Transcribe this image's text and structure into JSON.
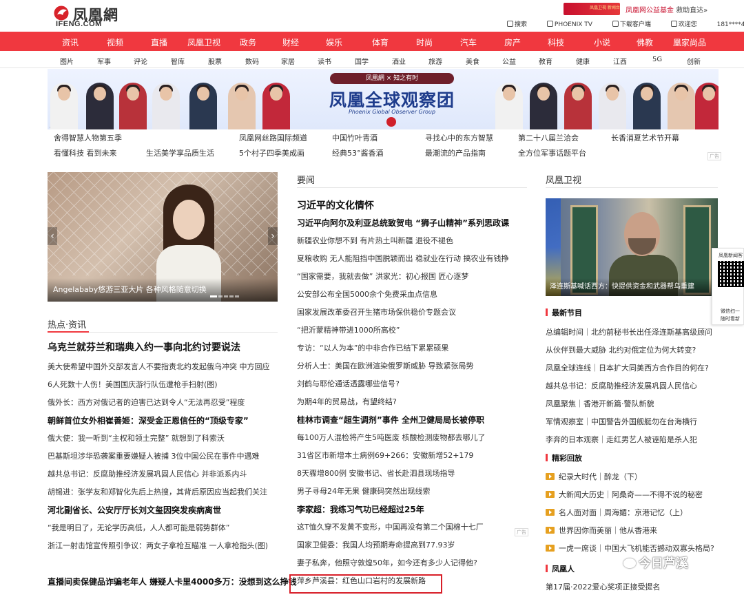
{
  "header": {
    "logo_cn": "凤凰網",
    "logo_en": "IFENG.COM",
    "banner_text": "凤凰卫视 新闻台",
    "fund_label": "凤凰网公益基金",
    "fund_link": "救助直达»",
    "links": [
      {
        "icon": "search-icon",
        "label": "搜索"
      },
      {
        "icon": "tv-icon",
        "label": "PHOENIX TV"
      },
      {
        "icon": "download-icon",
        "label": "下载客户端"
      },
      {
        "icon": "user-icon",
        "label": "欢迎您"
      },
      {
        "icon": "",
        "label": "181****4526 ∨ 退出"
      }
    ]
  },
  "nav": [
    "资讯",
    "视频",
    "直播",
    "凤凰卫视",
    "政务",
    "财经",
    "娱乐",
    "体育",
    "时尚",
    "汽车",
    "房产",
    "科技",
    "小说",
    "佛教",
    "凰家尚品"
  ],
  "subnav": [
    "图片",
    "军事",
    "评论",
    "智库",
    "股票",
    "数码",
    "家居",
    "读书",
    "国学",
    "酒业",
    "旅游",
    "美食",
    "公益",
    "教育",
    "健康",
    "江西",
    "5G",
    "创新"
  ],
  "banner": {
    "badge": "凤凰網 × 知之有时",
    "title": "凤凰全球观察团",
    "subtitle": "Phoenix Global Observer Group",
    "ad": "广告"
  },
  "link_grid": [
    [
      "舍得智慧人物第五季",
      "凤凰网丝路国际频道",
      "中国竹叶青酒",
      "寻找心中的东方智慧",
      "第二十八届兰洽会",
      "长香消夏艺术节开幕"
    ],
    [
      "看懂科技 看到未来",
      "生活美学享品质生活",
      "5个村子四季美成画",
      "经典53°酱香酒",
      "最潮流的产品指南",
      "全方位军事话题平台"
    ]
  ],
  "link_grid_ad": "广告",
  "slider": {
    "caption": "Angelababy悠游三亚大片 各种风格随意切换",
    "prev": "‹",
    "next": "›"
  },
  "hot": {
    "title": "热点·资讯",
    "rows": [
      {
        "t": "乌克兰就芬兰和瑞典入约一事向北约讨要说法",
        "style": "h"
      },
      {
        "t": "美大使希望中国外交部发言人不要指责北约发起俄乌冲突 中方回应",
        "style": ""
      },
      {
        "t": "6人死数十人伤！美国国庆游行队伍遭枪手扫射(图)",
        "style": ""
      },
      {
        "t": "俄外长：西方对俄记者的迫害已达到令人“无法再忍受”程度",
        "style": ""
      },
      {
        "t": "朝鲜首位女外相崔善姬：深受金正恩信任的“顶级专家”",
        "style": "b"
      },
      {
        "t": "俄大使：我一听到“主权和领土完整” 就想到了科索沃",
        "style": ""
      },
      {
        "t": "巴基斯坦涉华恐袭案重要嫌疑人被捕 3位中国公民在事件中遇难",
        "style": ""
      },
      {
        "t": "越共总书记：反腐助推经济发展巩固人民信心 并非派系内斗",
        "style": ""
      },
      {
        "t": "胡锡进：张学友和郑智化先后上热搜，其背后原因应当起我们关注",
        "style": ""
      },
      {
        "t": "河北副省长、公安厅厅长刘文玺因突发疾病离世",
        "style": "b"
      },
      {
        "t": "“我是明日了，无论学历高低，人人都可能是弱势群体”",
        "style": ""
      },
      {
        "t": "浙江一射击馆宣传照引争议：两女子拿枪互瞄准 一人拿枪指头(图)",
        "style": ""
      },
      {
        "t": "直播间卖保健品诈骗老年人 嫌疑人卡里4000多万：没想到这么挣钱",
        "style": "b"
      }
    ]
  },
  "news": {
    "title": "要闻",
    "rows": [
      {
        "t": "习近平的文化情怀",
        "style": "h"
      },
      {
        "t": "习近平向阿尔及利亚总统致贺电 “狮子山精神”系列思政课",
        "style": "b"
      },
      {
        "t": "新疆农业你想不到  有片热土叫新疆  退役不褪色",
        "style": ""
      },
      {
        "t": "夏粮收购  无人能阻挡中国脱颖而出  稳就业在行动  搞农业有钱挣",
        "style": ""
      },
      {
        "t": "“国家需要，我就去做”  洪家光：初心报国 匠心逐梦",
        "style": ""
      },
      {
        "t": "公安部公布全国5000余个免费采血点信息",
        "style": ""
      },
      {
        "t": "国家发展改革委召开生猪市场保供稳价专题会议",
        "style": ""
      },
      {
        "t": "“把沂蒙精神带进1000所高校”",
        "style": ""
      },
      {
        "t": "专访：“以人为本”的中非合作已结下累累硕果",
        "style": ""
      },
      {
        "t": "分析人士：美国在欧洲渲染俄罗斯威胁 导致紧张局势",
        "style": ""
      },
      {
        "t": "刘鹤与耶伦通话透露哪些信号?",
        "style": ""
      },
      {
        "t": "为期4年的贸易战，有望终结?",
        "style": ""
      },
      {
        "t": "桂林市调查“超生调剂”事件 全州卫健局局长被停职",
        "style": "b"
      },
      {
        "t": "每100万人混检将产生5吨医废 核酸检测废物都去哪儿了",
        "style": ""
      },
      {
        "t": "31省区市新增本土病例69+266：安徽新增52+179",
        "style": ""
      },
      {
        "t": "8天骤增800例 安徽书记、省长赴泗县现场指导",
        "style": ""
      },
      {
        "t": "男子寻母24年无果 健康码突然出现线索",
        "style": ""
      },
      {
        "t": "李家超：我练习气功已经超过25年",
        "style": "b"
      },
      {
        "t": "这T恤久穿不发黄不变形，中国再没有第二个国棉十七厂",
        "style": ""
      },
      {
        "t": "国家卫健委：我国人均预期寿命提高到77.93岁",
        "style": ""
      },
      {
        "t": "妻子私奔，他照守敦煌50年，如今还有多少人记得他?",
        "style": ""
      },
      {
        "t": "萍乡芦溪县：红色山口岩村的发展新路",
        "style": ""
      }
    ],
    "ad1": "广告",
    "ad2": "广告"
  },
  "tv": {
    "title": "凤凰卫视",
    "caption": "泽连斯基喊话西方：快提供资金和武器帮乌重建"
  },
  "right": {
    "sec1": "最新节目",
    "sec1_rows": [
      "总编辑时间｜北约前秘书长出任泽连斯基高级顾问",
      "从伙伴到最大威胁 北约对俄定位为何大转变?",
      "凤凰全球连线｜日本扩大同美西方合作目的何在?",
      "越共总书记：反腐助推经济发展巩固人民信心",
      "凤凰聚焦｜香港开新篇·警队新貌",
      "军情观察室｜中国警告外国舰艇勿在台海横行",
      "李奔的日本观察｜走红男艺人被诬陷是杀人犯"
    ],
    "sec2": "精彩回放",
    "sec2_rows": [
      "纪录大时代｜醉龙（下）",
      "大新闻大历史｜阿桑奇——不得不说的秘密",
      "名人面对面｜周海媚：京港记忆（上）",
      "世界因你而美丽｜他从香港来",
      "一虎一席谈｜中国大飞机能否撼动双寡头格局?"
    ],
    "sec3": "凤凰人",
    "sec3_rows": [
      "第17届·2022爱心奖项正接受提名"
    ]
  },
  "qr": {
    "top": "凤凰新闻客",
    "b1": "微信扫一",
    "b2": "随时看新"
  },
  "watermark": "今日芦溪",
  "colors": {
    "accent": "#f0383f",
    "highlight": "#d81e28"
  }
}
